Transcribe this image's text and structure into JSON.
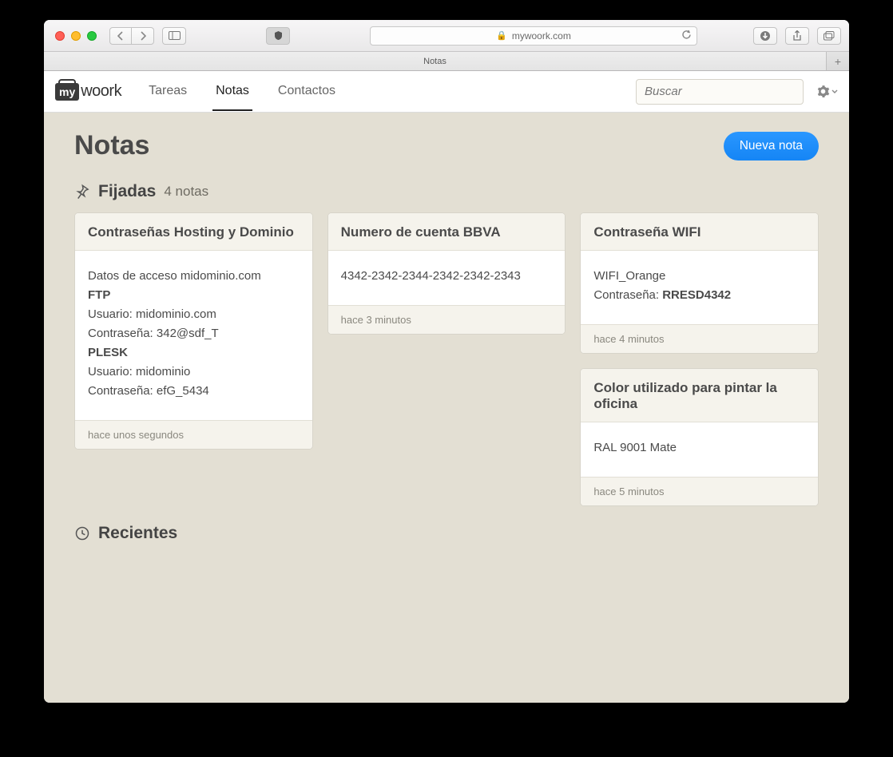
{
  "browser": {
    "url_display": "mywoork.com",
    "tab_title": "Notas"
  },
  "header": {
    "logo_badge": "my",
    "logo_text": "woork",
    "nav": [
      {
        "label": "Tareas",
        "active": false
      },
      {
        "label": "Notas",
        "active": true
      },
      {
        "label": "Contactos",
        "active": false
      }
    ],
    "search_placeholder": "Buscar"
  },
  "page": {
    "title": "Notas",
    "new_button": "Nueva nota",
    "pinned": {
      "label": "Fijadas",
      "count_label": "4 notas"
    },
    "recent": {
      "label": "Recientes"
    }
  },
  "cards": [
    {
      "title": "Contraseñas Hosting y Dominio",
      "lines": [
        {
          "text": "Datos de acceso midominio.com",
          "bold": false
        },
        {
          "text": "FTP",
          "bold": true
        },
        {
          "text": "Usuario: midominio.com",
          "bold": false
        },
        {
          "text": "Contraseña: 342@sdf_T",
          "bold": false
        },
        {
          "text": "PLESK",
          "bold": true
        },
        {
          "text": "Usuario: midominio",
          "bold": false
        },
        {
          "text": "Contraseña: efG_5434",
          "bold": false
        }
      ],
      "time": "hace unos segundos"
    },
    {
      "title": "Numero de cuenta BBVA",
      "lines": [
        {
          "text": "4342-2342-2344-2342-2342-2343",
          "bold": false
        }
      ],
      "time": "hace 3 minutos"
    },
    {
      "title": "Contraseña WIFI",
      "lines": [
        {
          "text": "WIFI_Orange",
          "bold": false
        },
        {
          "prefix": "Contraseña: ",
          "strong": "RRESD4342"
        }
      ],
      "time": "hace 4 minutos"
    },
    {
      "title": "Color utilizado para pintar la oficina",
      "lines": [
        {
          "text": "RAL 9001 Mate",
          "bold": false
        }
      ],
      "time": "hace 5 minutos"
    }
  ]
}
